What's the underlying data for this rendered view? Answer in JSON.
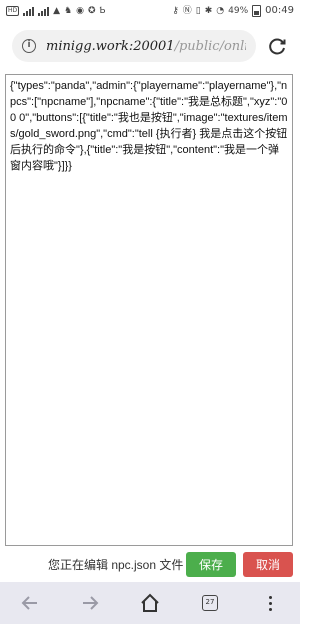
{
  "status_bar": {
    "battery": "49%",
    "time": "00:49"
  },
  "address_bar": {
    "host": "minigg.work:20001",
    "path": "/public/onlinefs_"
  },
  "editor": {
    "content": "{\"types\":\"panda\",\"admin\":{\"playername\":\"playername\"},\"npcs\":[\"npcname\"],\"npcname\":{\"title\":\"我是总标题\",\"xyz\":\"0 0 0\",\"buttons\":[{\"title\":\"我也是按钮\",\"image\":\"textures/items/gold_sword.png\",\"cmd\":\"tell {执行者} 我是点击这个按钮后执行的命令\"},{\"title\":\"我是按钮\",\"content\":\"我是一个弹窗内容哦\"}]}}"
  },
  "footer": {
    "status_text": "您正在编辑 npc.json 文件",
    "save_label": "保存",
    "cancel_label": "取消"
  },
  "nav_bar": {
    "tab_count": "27"
  }
}
